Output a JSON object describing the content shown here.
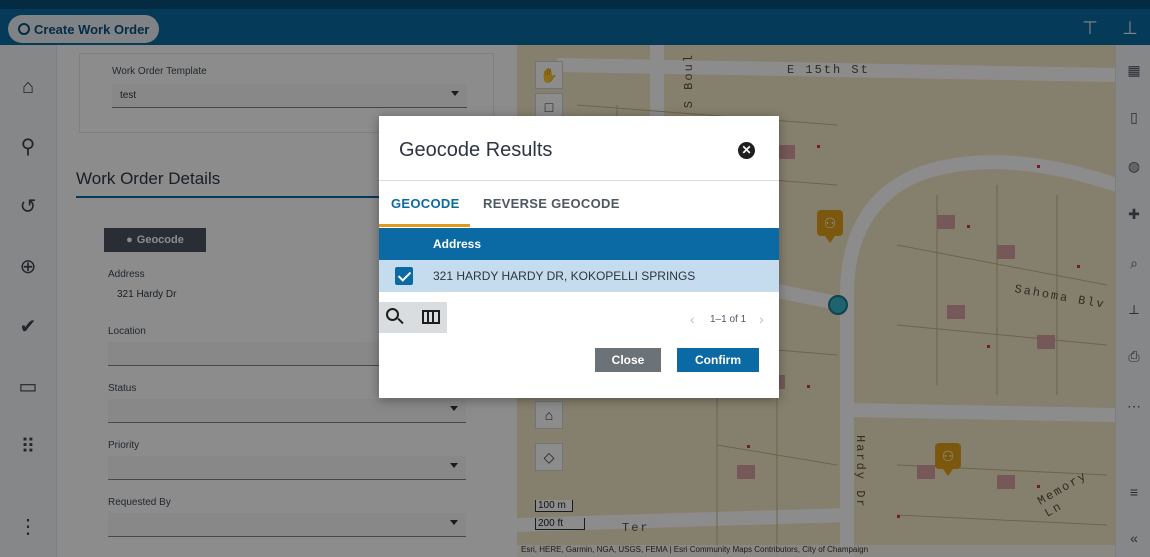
{
  "header": {
    "create_label": "Create Work Order",
    "icons": [
      "pin-toolbar-icon",
      "expand-toolbar-icon"
    ]
  },
  "leftnav": {
    "items": [
      {
        "name": "home-icon",
        "glyph": "⌂"
      },
      {
        "name": "workflow-icon",
        "glyph": "⚲"
      },
      {
        "name": "history-icon",
        "glyph": "↺"
      },
      {
        "name": "add-icon",
        "glyph": "⊕"
      },
      {
        "name": "check-icon",
        "glyph": "✔"
      },
      {
        "name": "card-icon",
        "glyph": "▭"
      },
      {
        "name": "apps-grid-icon",
        "glyph": "⠿"
      },
      {
        "name": "more-vertical-icon",
        "glyph": "⋮"
      }
    ]
  },
  "form": {
    "template_label": "Work Order Template",
    "template_value": "test",
    "section_title": "Work Order Details",
    "geocode_button": "Geocode",
    "address_label": "Address",
    "address_value": "321 Hardy Dr",
    "location_label": "Location",
    "status_label": "Status",
    "priority_label": "Priority",
    "requested_by_label": "Requested By"
  },
  "map": {
    "street_labels": [
      "E 15th St",
      "S Boul",
      "Sahoma Blv",
      "Hardy Dr",
      "Memory Ln",
      "Ter"
    ],
    "scale": [
      "100 m",
      "200 ft"
    ],
    "attribution": "Esri, HERE, Garmin, NGA, USGS, FEMA | Esri Community Maps Contributors, City of Champaign"
  },
  "modal": {
    "title": "Geocode Results",
    "tabs": [
      {
        "label": "GEOCODE",
        "active": true
      },
      {
        "label": "REVERSE GEOCODE",
        "active": false
      }
    ],
    "table": {
      "columns": [
        "Address"
      ],
      "rows": [
        {
          "checked": true,
          "address": "321 HARDY HARDY DR, KOKOPELLI SPRINGS"
        }
      ]
    },
    "pager": "1–1 of 1",
    "close_label": "Close",
    "confirm_label": "Confirm"
  },
  "colors": {
    "primary": "#0b6aa3",
    "accent": "#e39a1b",
    "selected_row": "#c4dced",
    "close_button": "#6b7278"
  }
}
